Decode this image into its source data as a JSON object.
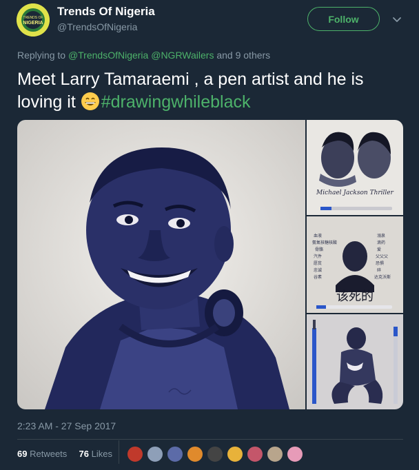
{
  "author": {
    "name": "Trends Of Nigeria",
    "handle": "@TrendsOfNigeria",
    "avatar_label": "TRENDS OF NIGERIA"
  },
  "follow_label": "Follow",
  "reply": {
    "prefix": "Replying to",
    "mention1": "@TrendsOfNigeria",
    "mention2": "@NGRWailers",
    "suffix": "and 9 others"
  },
  "tweet": {
    "text": "Meet Larry Tamaraemi , a pen artist and he is loving it",
    "hashtag": "#drawingwhileblack",
    "emoji": "grinning-face"
  },
  "media": {
    "image2_caption": "Michael Jackson Thriller",
    "image3_caption": "该死的"
  },
  "timestamp": "2:23 AM - 27 Sep 2017",
  "stats": {
    "retweets_count": "69",
    "retweets_label": "Retweets",
    "likes_count": "76",
    "likes_label": "Likes"
  },
  "colors": {
    "background": "#1b2836",
    "accent": "#4db26a",
    "muted": "#8899a6"
  }
}
